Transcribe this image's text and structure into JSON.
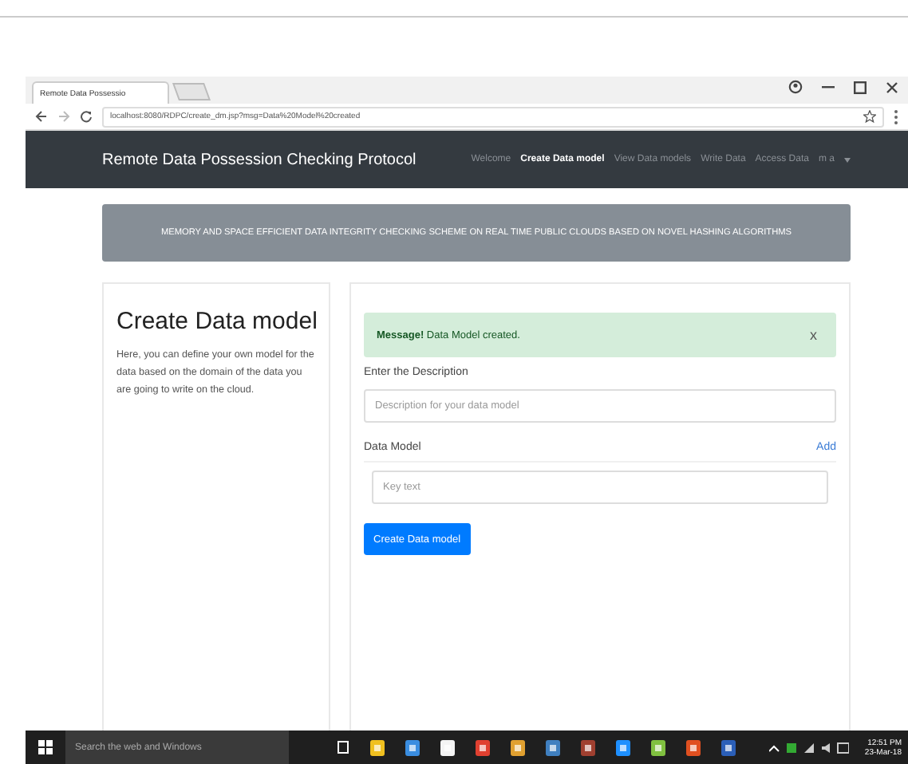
{
  "browser": {
    "tab_title": "Remote Data Possessio",
    "address": "localhost:8080/RDPC/create_dm.jsp?msg=Data%20Model%20created"
  },
  "navbar": {
    "brand": "Remote Data Possession Checking Protocol",
    "items": [
      {
        "label": "Welcome",
        "selected": false
      },
      {
        "label": "Create Data model",
        "selected": true
      },
      {
        "label": "View Data models",
        "selected": false
      },
      {
        "label": "Write Data",
        "selected": false
      },
      {
        "label": "Access Data",
        "selected": false
      }
    ],
    "user": "m a"
  },
  "banner": "MEMORY AND SPACE EFFICIENT DATA INTEGRITY CHECKING SCHEME ON REAL TIME PUBLIC CLOUDS BASED ON NOVEL HASHING ALGORITHMS",
  "intro": {
    "title": "Create Data model",
    "text": "Here, you can define your own model for the data based on the domain of the data you are going to write on the cloud."
  },
  "alert": {
    "label": "Message!",
    "text": "Data Model created.",
    "close": "x"
  },
  "description": {
    "label": "Enter the Description",
    "placeholder": "Description for your data model"
  },
  "data_model": {
    "label": "Data Model",
    "add": "Add",
    "placeholder": "Key text"
  },
  "submit": "Create Data model",
  "taskbar": {
    "search_placeholder": "Search the web and Windows",
    "time": "12:51 PM",
    "date": "23-Mar-18"
  }
}
